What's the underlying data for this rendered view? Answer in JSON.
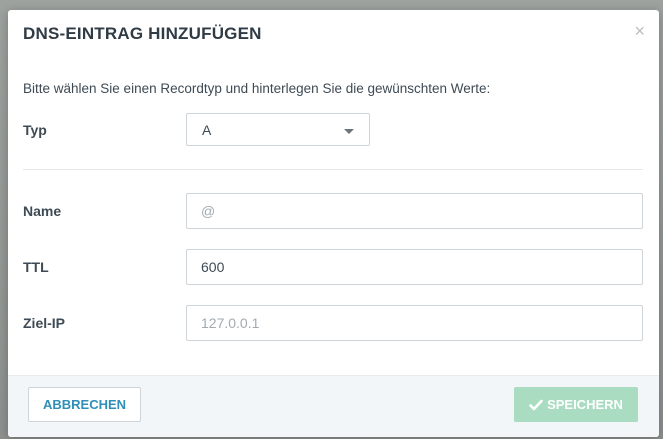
{
  "dialog": {
    "title": "DNS-EINTRAG HINZUFÜGEN",
    "close_glyph": "×",
    "intro": "Bitte wählen Sie einen Recordtyp und hinterlegen Sie die gewünschten Werte:"
  },
  "form": {
    "type": {
      "label": "Typ",
      "selected": "A"
    },
    "name": {
      "label": "Name",
      "value": "",
      "placeholder": "@"
    },
    "ttl": {
      "label": "TTL",
      "value": "600",
      "placeholder": ""
    },
    "target_ip": {
      "label": "Ziel-IP",
      "value": "",
      "placeholder": "127.0.0.1"
    }
  },
  "footer": {
    "cancel_label": "ABBRECHEN",
    "save_label": "SPEICHERN"
  },
  "colors": {
    "title": "#2f3b45",
    "cancel_text": "#2f8fb8",
    "save_bg": "#a9dcc1",
    "footer_bg": "#f3f6f8"
  },
  "icons": {
    "close": "close-icon",
    "caret": "chevron-down-icon",
    "save": "check-icon"
  }
}
